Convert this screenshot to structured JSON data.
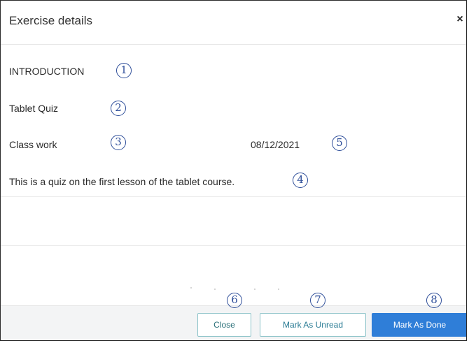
{
  "dialog": {
    "title": "Exercise details",
    "close_icon": "×"
  },
  "fields": {
    "category": "INTRODUCTION",
    "name": "Tablet Quiz",
    "type": "Class work",
    "date": "08/12/2021",
    "description": "This is a quiz on the first lesson of the tablet course."
  },
  "markers": {
    "m1": "1",
    "m2": "2",
    "m3": "3",
    "m4": "4",
    "m5": "5",
    "m6": "6",
    "m7": "7",
    "m8": "8"
  },
  "footer": {
    "close_label": "Close",
    "mark_unread_label": "Mark As Unread",
    "mark_done_label": "Mark As Done"
  },
  "colors": {
    "primary_button": "#2f7ed8",
    "outline_button_border": "#8bc2c8",
    "marker": "#2f4f9a"
  }
}
